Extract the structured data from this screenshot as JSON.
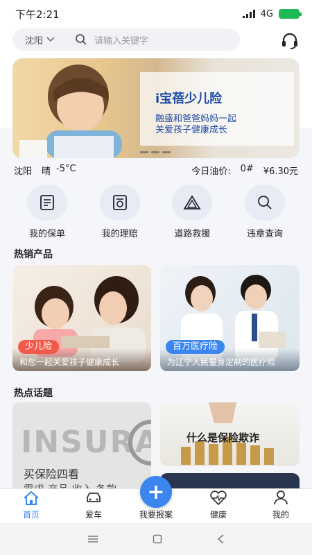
{
  "status": {
    "time": "下午2:21",
    "network": "4G"
  },
  "search": {
    "city": "沈阳",
    "placeholder": "请输入关键字"
  },
  "banner": {
    "title": "i宝蓓少儿险",
    "subtitle_line1": "融盛和爸爸妈妈一起",
    "subtitle_line2": "关爱孩子健康成长"
  },
  "info": {
    "city": "沈阳",
    "weather": "晴",
    "temp": "-5°C",
    "oil_label": "今日油价:",
    "oil_grade": "0#",
    "oil_price": "¥6.30元"
  },
  "grid": [
    {
      "label": "我的保单",
      "icon": "policy-icon"
    },
    {
      "label": "我的理赔",
      "icon": "claim-icon"
    },
    {
      "label": "道路救援",
      "icon": "road-rescue-icon"
    },
    {
      "label": "违章查询",
      "icon": "violation-search-icon"
    }
  ],
  "sections": {
    "hot_products": "热销产品",
    "hot_topics": "热点话题"
  },
  "products": [
    {
      "tag": "少儿险",
      "caption": "和您一起关爱孩子健康成长",
      "tag_color": "#f05a4a"
    },
    {
      "tag": "百万医疗险",
      "caption": "为辽宁人民量身定制的医疗险",
      "tag_color": "#3a86ee"
    }
  ],
  "topics": [
    {
      "image_text": "INSURA",
      "title": "买保险四看",
      "subtitle": "需求 产品 收入 条款"
    },
    {
      "title": "什么是保险欺诈"
    }
  ],
  "nav": [
    {
      "label": "首页",
      "icon": "home-icon",
      "active": true
    },
    {
      "label": "爱车",
      "icon": "car-icon",
      "active": false
    },
    {
      "label": "我要报案",
      "icon": "report-icon",
      "active": false
    },
    {
      "label": "健康",
      "icon": "health-icon",
      "active": false
    },
    {
      "label": "我的",
      "icon": "profile-icon",
      "active": false
    }
  ],
  "fab_symbol": "+",
  "accent": "#3a86ee"
}
